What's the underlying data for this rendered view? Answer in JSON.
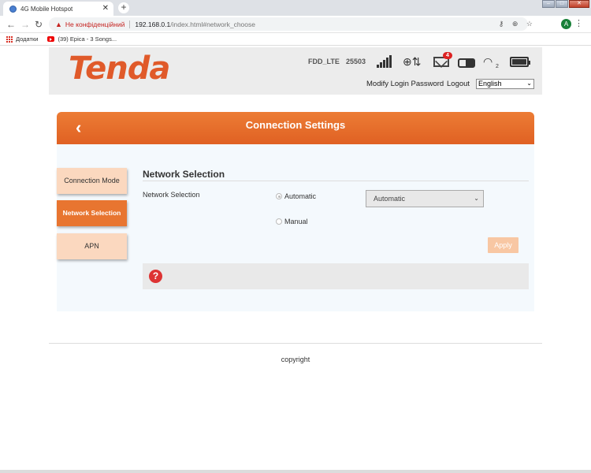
{
  "browser": {
    "tab_title": "4G Mobile Hotspot",
    "tab_close": "✕",
    "new_tab": "+",
    "security_warning": "Не конфіденційний",
    "url_host": "192.168.0.1",
    "url_path": "/index.html#network_choose",
    "bookmarks": [
      "Додатки",
      "(39) Epica - 3 Songs..."
    ],
    "profile_initial": "A"
  },
  "header": {
    "logo": "Tenda",
    "network_type": "FDD_LTE",
    "operator_code": "25503",
    "unread_messages": "4",
    "wifi_clients": "2",
    "modify_password": "Modify Login Password",
    "logout": "Logout",
    "language": "English"
  },
  "page": {
    "title": "Connection Settings",
    "back": "‹"
  },
  "sidebar": {
    "items": [
      {
        "label": "Connection Mode"
      },
      {
        "label": "Network Selection"
      },
      {
        "label": "APN"
      }
    ],
    "active": "Network Selection"
  },
  "form": {
    "section_title": "Network Selection",
    "field_label": "Network Selection",
    "option_auto": "Automatic",
    "option_manual": "Manual",
    "select_value": "Automatic",
    "apply": "Apply",
    "help": "?"
  },
  "footer": {
    "copyright": "copyright"
  },
  "colors": {
    "accent": "#e87530",
    "header_bg": "#ececec",
    "logo": "#e05a2a"
  }
}
